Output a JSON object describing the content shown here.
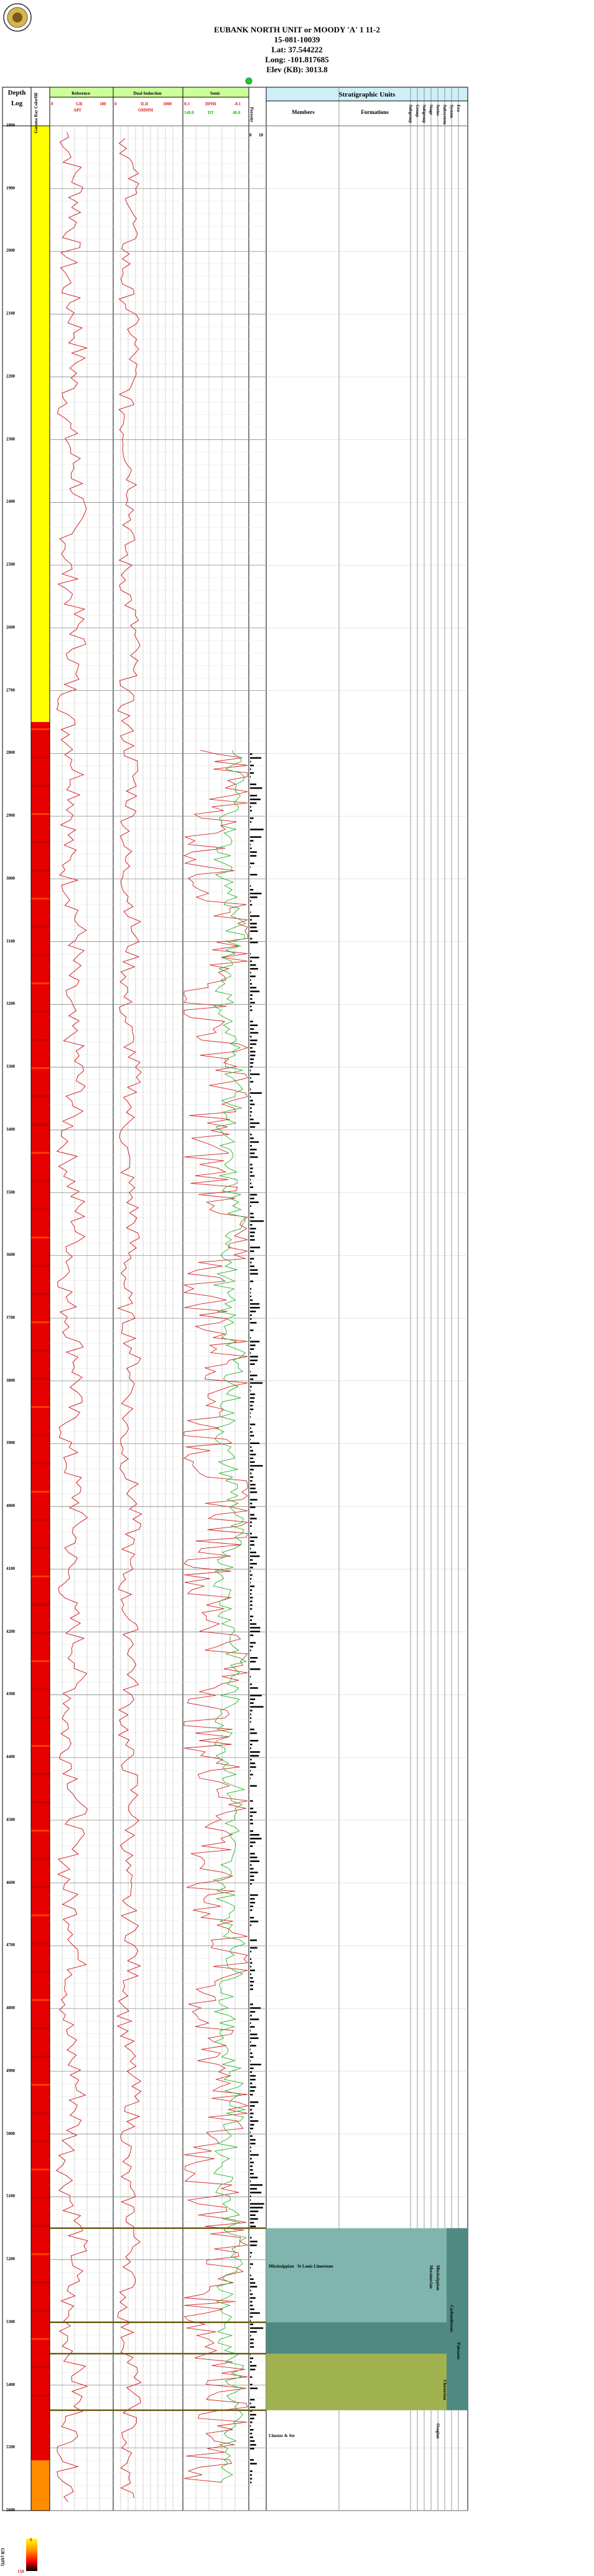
{
  "header": {
    "well_name": "EUBANK NORTH UNIT or MOODY 'A' 1 11-2",
    "api": "15-081-10039",
    "lat": "Lat: 37.544222",
    "long": "Long: -101.817685",
    "elev": "Elev (KB): 3013.8"
  },
  "tracks": {
    "depth_title": "Depth",
    "log_title": "Log",
    "gr_track_title": "Gamma Ray Colorfill",
    "reference_title": "Reference",
    "reference_curve": "GR",
    "reference_min": "0",
    "reference_max": "100",
    "reference_unit": "API",
    "induction_title": "Dual Induction",
    "induction_curve": "ILD",
    "induction_min": "0",
    "induction_max": "1000",
    "induction_unit": "OHMM",
    "sonic_title": "Sonic",
    "sonic_curve1": "DPHI",
    "sonic_curve1_min": "0.3",
    "sonic_curve1_max": "-0.1",
    "sonic_curve2": "DT",
    "sonic_curve2_min": "140.0",
    "sonic_curve2_max": "40.0",
    "porosity_title": "Porosity",
    "porosity_min": "0",
    "porosity_max": "10",
    "strat_title": "Stratigraphic Units",
    "members_title": "Members",
    "formations_title": "Formations",
    "strat_columns": [
      "Subgroup",
      "Group",
      "Subgroup",
      "Stage",
      "Series",
      "Subsystem",
      "System",
      "Era"
    ]
  },
  "depths": [
    "1800",
    "1900",
    "2000",
    "2100",
    "2200",
    "2300",
    "2400",
    "2500",
    "2600",
    "2700",
    "2800",
    "2900",
    "3000",
    "3100",
    "3200",
    "3300",
    "3400",
    "3500",
    "3600",
    "3700",
    "3800",
    "3900",
    "4000",
    "4100",
    "4200",
    "4300",
    "4400",
    "4500",
    "4600",
    "4700",
    "4800",
    "4900",
    "5000",
    "5100",
    "5200",
    "5300",
    "5400",
    "5500",
    "5600"
  ],
  "strat_units": {
    "member1": "Mississippian",
    "formation1": "St Louis Limestone",
    "member2": "Chester & Ste",
    "series1": "Mississippian",
    "series2": "Meramecian",
    "system1": "Carboniferous",
    "system2": "Paleozoic",
    "series3": "Chesterian",
    "stage1": "Osagian"
  },
  "legend": {
    "title": "GR (API)",
    "min": "0",
    "max": "150"
  },
  "colors": {
    "yellow": "#ffff00",
    "red": "#e60000",
    "orange": "#ff8c00",
    "teal_dark": "#4f8a82",
    "teal": "#7fb5ad",
    "olive": "#9fb24f",
    "curve_red": "#d42020",
    "curve_green": "#22b022",
    "strat_header_bg": "#cfeff7"
  }
}
